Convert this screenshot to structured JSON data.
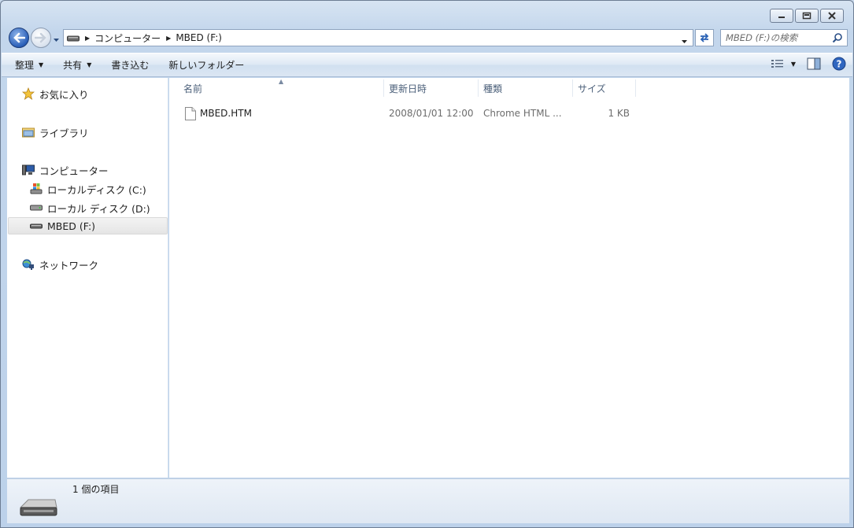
{
  "window": {
    "controls": [
      "minimize",
      "maximize",
      "close"
    ]
  },
  "address": {
    "crumbs": [
      "コンピューター",
      "MBED (F:)"
    ]
  },
  "search": {
    "placeholder": "MBED (F:)の検索"
  },
  "toolbar": {
    "organize": "整理",
    "share": "共有",
    "burn": "書き込む",
    "new_folder": "新しいフォルダー"
  },
  "nav": {
    "favorites": "お気に入り",
    "libraries": "ライブラリ",
    "computer": "コンピューター",
    "drive_c": "ローカルディスク (C:)",
    "drive_d": "ローカル ディスク (D:)",
    "drive_f": "MBED (F:)",
    "network": "ネットワーク"
  },
  "columns": {
    "name": "名前",
    "date": "更新日時",
    "type": "種類",
    "size": "サイズ"
  },
  "files": [
    {
      "name": "MBED.HTM",
      "date": "2008/01/01 12:00",
      "type": "Chrome HTML ...",
      "size": "1 KB"
    }
  ],
  "details": {
    "count": "1 個の項目"
  }
}
